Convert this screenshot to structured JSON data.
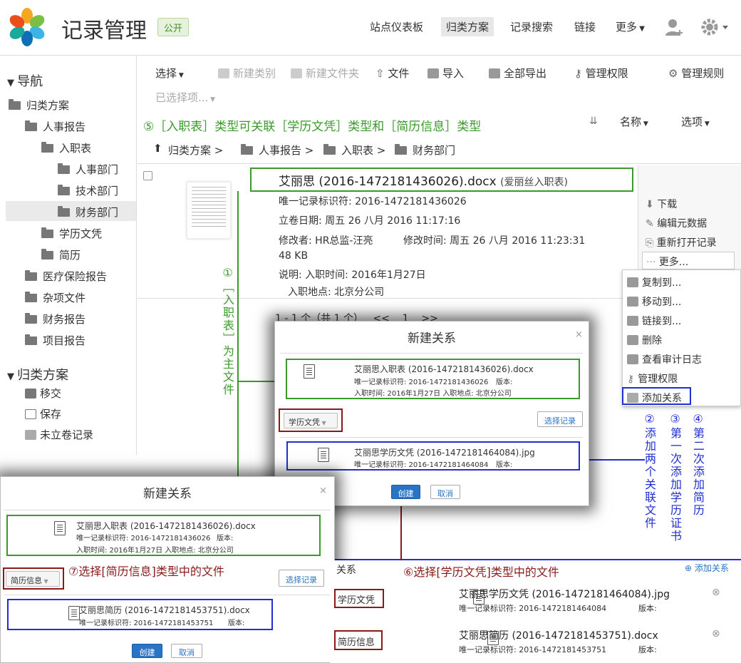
{
  "header": {
    "title": "记录管理",
    "badge": "公开",
    "nav": [
      "站点仪表板",
      "归类方案",
      "记录搜索",
      "链接",
      "更多"
    ],
    "colors": {
      "brand_green": "#3a9a2a",
      "annotation_blue": "#1f2fd0",
      "annotation_red": "#8a1a1a"
    }
  },
  "sidebar": {
    "nav_heading": "导航",
    "tree": [
      "归类方案",
      "人事报告",
      "入职表",
      "人事部门",
      "技术部门",
      "财务部门",
      "学历文凭",
      "简历",
      "医疗保险报告",
      "杂项文件",
      "财务报告",
      "项目报告"
    ],
    "plan_heading": "归类方案",
    "actions": [
      "移交",
      "保存",
      "未立卷记录"
    ]
  },
  "toolbar": {
    "select": "选择",
    "new_category": "新建类别",
    "new_folder": "新建文件夹",
    "file": "文件",
    "import": "导入",
    "export_all": "全部导出",
    "manage_perm": "管理权限",
    "manage_rules": "管理规则",
    "selected": "已选择项...",
    "sort": "名称",
    "options": "选项"
  },
  "annotations": {
    "a5": "⑤［入职表］类型可关联［学历文凭］类型和［简历信息］类型",
    "a1": "①［入职表］为主文件",
    "a2": "②添加两个关联文件",
    "a3": "③第一次添加学历证书",
    "a4": "④第二次添加简历",
    "a6": "⑥选择[学历文凭]类型中的文件",
    "a7": "⑦选择[简历信息]类型中的文件"
  },
  "breadcrumb": [
    "归类方案",
    "人事报告",
    "入职表",
    "财务部门"
  ],
  "record": {
    "title": "艾丽思 (2016-1472181436026).docx",
    "subtitle": "(爱丽丝入职表)",
    "uid": "唯一记录标识符: 2016-1472181436026",
    "filed_date": "立卷日期: 周五 26 八月 2016 11:17:16",
    "modifier": "修改者: HR总监-汪亮",
    "modified": "修改时间: 周五 26 八月 2016 11:23:31",
    "size": "48 KB",
    "desc": "说明: 入职时间: 2016年1月27日",
    "desc2": "入职地点: 北京分公司",
    "pager": "1 - 1 个（共 1 个）",
    "pager_prev": "<<",
    "pager_page": "1",
    "pager_next": ">>"
  },
  "actions": [
    "下载",
    "编辑元数据",
    "重新打开记录",
    "更多..."
  ],
  "more_menu": [
    "复制到...",
    "移动到...",
    "链接到...",
    "删除",
    "查看审计日志",
    "管理权限",
    "添加关系"
  ],
  "dialog1": {
    "title": "新建关系",
    "close": "×",
    "main_name": "艾丽思入职表 (2016-1472181436026).docx",
    "main_uid": "唯一记录标识符: 2016-1472181436026",
    "main_ver": "版本:",
    "main_desc": "入职时间: 2016年1月27日 入职地点: 北京分公司",
    "select_type": "学历文凭",
    "select_record": "选择记录",
    "rel_name": "艾丽思学历文凭 (2016-1472181464084).jpg",
    "rel_uid": "唯一记录标识符: 2016-1472181464084",
    "rel_ver": "版本:",
    "create": "创建",
    "cancel": "取消"
  },
  "dialog2": {
    "title": "新建关系",
    "close": "×",
    "main_name": "艾丽思入职表 (2016-1472181436026).docx",
    "main_uid": "唯一记录标识符: 2016-1472181436026",
    "main_ver": "版本:",
    "main_desc": "入职时间: 2016年1月27日 入职地点: 北京分公司",
    "select_type": "简历信息",
    "select_record": "选择记录",
    "rel_name": "艾丽思简历 (2016-1472181453751).docx",
    "rel_uid": "唯一记录标识符: 2016-1472181453751",
    "rel_ver": "版本:",
    "create": "创建",
    "cancel": "取消"
  },
  "relations": {
    "heading": "关系",
    "add": "添加关系",
    "rows": [
      {
        "type": "学历文凭",
        "name": "艾丽思学历文凭 (2016-1472181464084).jpg",
        "uid": "唯一记录标识符: 2016-1472181464084",
        "ver": "版本:"
      },
      {
        "type": "简历信息",
        "name": "艾丽思简历 (2016-1472181453751).docx",
        "uid": "唯一记录标识符: 2016-1472181453751",
        "ver": "版本:"
      }
    ]
  }
}
